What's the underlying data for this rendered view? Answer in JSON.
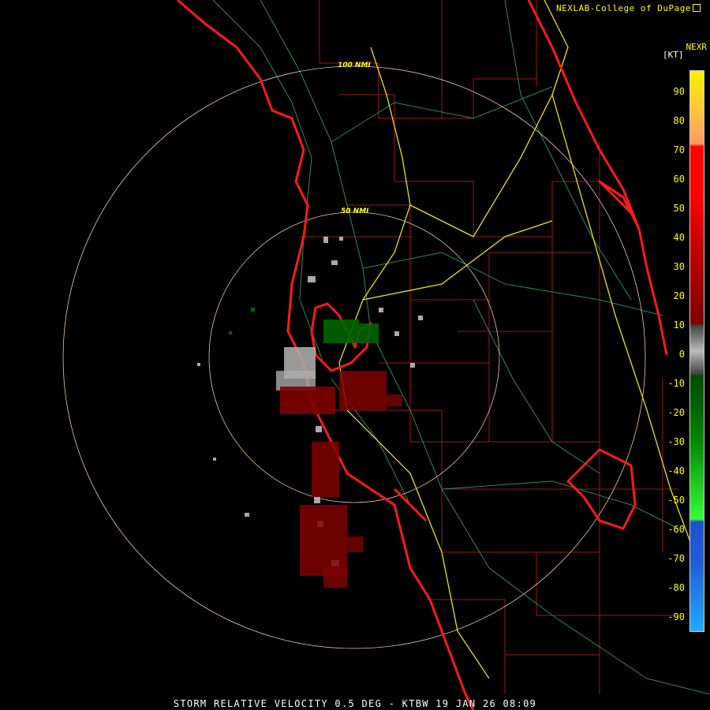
{
  "credit": {
    "text": "NEXLAB-College of DuPage",
    "icon": "external-link-icon"
  },
  "product": "NEXR",
  "units": "[KT]",
  "footer": "STORM RELATIVE VELOCITY 0.5 DEG - KTBW 19 JAN 26 08:09",
  "rings": {
    "inner_label": "50 NMI",
    "outer_label": "100 NMI"
  },
  "colorbar": {
    "ticks": [
      "90",
      "80",
      "70",
      "60",
      "50",
      "40",
      "30",
      "20",
      "10",
      "0",
      "-10",
      "-20",
      "-30",
      "-40",
      "-50",
      "-60",
      "-70",
      "-80",
      "-90"
    ],
    "colors": {
      "top": "#ffee00",
      "orange": "#ff9966",
      "red": "#ff0000",
      "darkred": "#800000",
      "gray": "#aaaaaa",
      "darkgreen": "#006400",
      "green": "#33ff33",
      "blue": "#1f5fd6",
      "lightblue": "#22aaff"
    }
  },
  "map_colors": {
    "coast": "#ff1a1a",
    "county": "#a01818",
    "roads": "#2e8b57",
    "highway": "#e6e600"
  }
}
